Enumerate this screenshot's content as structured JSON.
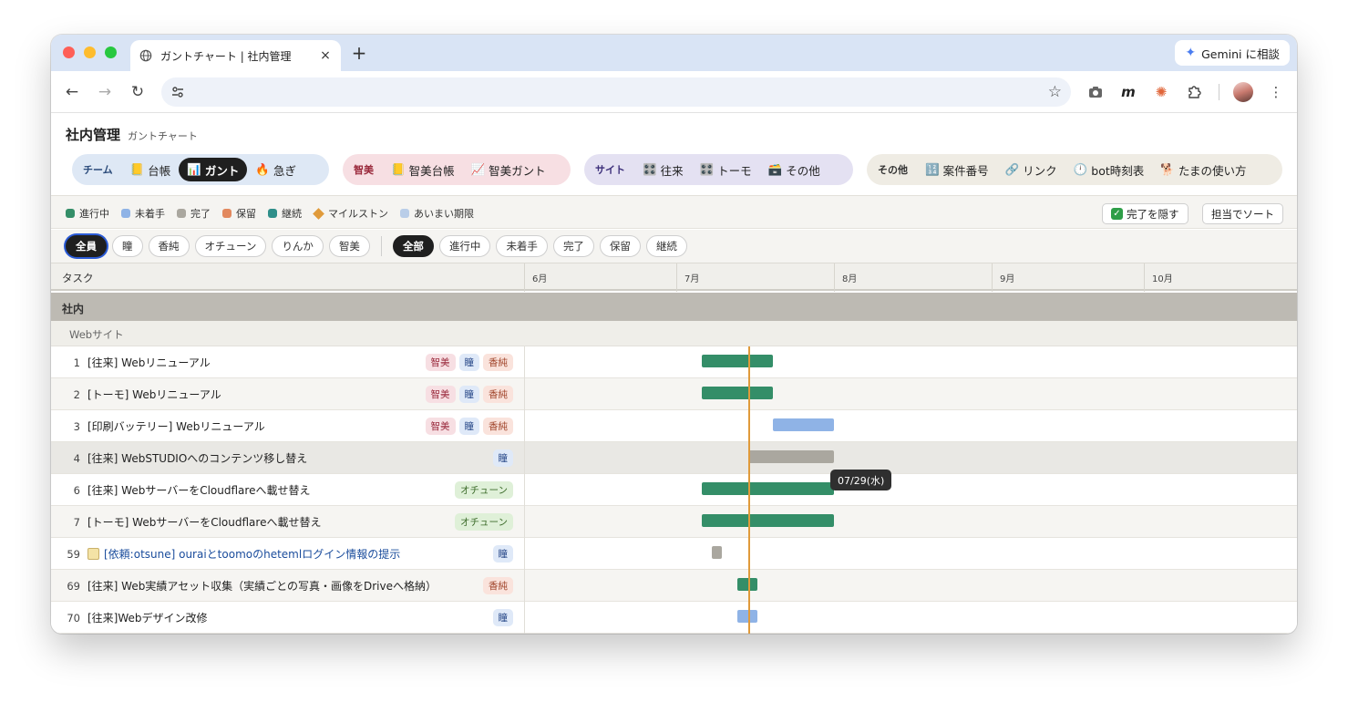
{
  "browser": {
    "tab_title": "ガントチャート | 社内管理",
    "new_tab": "+",
    "close": "×",
    "gemini_label": "Gemini に相談"
  },
  "app": {
    "title": "社内管理",
    "subtitle": "ガントチャート"
  },
  "nav_groups": [
    {
      "label": "チーム",
      "items": [
        {
          "icon": "ledger-icon",
          "glyph": "📒",
          "label": "台帳"
        },
        {
          "icon": "chart-icon",
          "glyph": "📊",
          "label": "ガント",
          "active": true
        },
        {
          "icon": "fire-icon",
          "glyph": "🔥",
          "label": "急ぎ"
        }
      ]
    },
    {
      "label": "智美",
      "items": [
        {
          "icon": "ledger-icon",
          "glyph": "📒",
          "label": "智美台帳"
        },
        {
          "icon": "chart-up-icon",
          "glyph": "📈",
          "label": "智美ガント"
        }
      ]
    },
    {
      "label": "サイト",
      "items": [
        {
          "icon": "grid-icon",
          "glyph": "🎛️",
          "label": "往来"
        },
        {
          "icon": "grid-icon",
          "glyph": "🎛️",
          "label": "トーモ"
        },
        {
          "icon": "box-icon",
          "glyph": "🗃️",
          "label": "その他"
        }
      ]
    },
    {
      "label": "その他",
      "items": [
        {
          "icon": "numbers-icon",
          "glyph": "🔢",
          "label": "案件番号"
        },
        {
          "icon": "link-icon",
          "glyph": "🔗",
          "label": "リンク"
        },
        {
          "icon": "clock-icon",
          "glyph": "🕛",
          "label": "bot時刻表"
        },
        {
          "icon": "dog-icon",
          "glyph": "🐕",
          "label": "たまの使い方"
        }
      ]
    }
  ],
  "legend": [
    {
      "label": "進行中",
      "color": "#348e68",
      "shape": "square"
    },
    {
      "label": "未着手",
      "color": "#8fb3e6",
      "shape": "square"
    },
    {
      "label": "完了",
      "color": "#aaa79f",
      "shape": "square"
    },
    {
      "label": "保留",
      "color": "#e2895f",
      "shape": "square"
    },
    {
      "label": "継続",
      "color": "#2f8f8a",
      "shape": "square"
    },
    {
      "label": "マイルストン",
      "color": "#e09a3a",
      "shape": "diamond"
    },
    {
      "label": "あいまい期限",
      "color": "#b9cde8",
      "shape": "square"
    }
  ],
  "actions": {
    "hide_done": "完了を隠す",
    "sort_by_owner": "担当でソート"
  },
  "member_filters": [
    {
      "label": "全員",
      "selected": true
    },
    {
      "label": "瞳"
    },
    {
      "label": "香純"
    },
    {
      "label": "オチューン"
    },
    {
      "label": "りんか"
    },
    {
      "label": "智美"
    }
  ],
  "status_filters": [
    {
      "label": "全部",
      "selected": true
    },
    {
      "label": "進行中"
    },
    {
      "label": "未着手"
    },
    {
      "label": "完了"
    },
    {
      "label": "保留"
    },
    {
      "label": "継続"
    }
  ],
  "gantt": {
    "task_header": "タスク",
    "months": [
      "6月",
      "7月",
      "8月",
      "9月",
      "10月"
    ],
    "section": "社内",
    "subsection": "Webサイト",
    "tooltip": "07/29(水)",
    "rows": [
      {
        "num": "1",
        "name": "[往来] Webリニューアル",
        "tags": [
          {
            "t": "智美",
            "c": "pink"
          },
          {
            "t": "瞳",
            "c": "blue"
          },
          {
            "t": "香純",
            "c": "salmon"
          }
        ],
        "status": "prog"
      },
      {
        "num": "2",
        "name": "[トーモ] Webリニューアル",
        "tags": [
          {
            "t": "智美",
            "c": "pink"
          },
          {
            "t": "瞳",
            "c": "blue"
          },
          {
            "t": "香純",
            "c": "salmon"
          }
        ],
        "status": "prog"
      },
      {
        "num": "3",
        "name": "[印刷バッテリー] Webリニューアル",
        "tags": [
          {
            "t": "智美",
            "c": "pink"
          },
          {
            "t": "瞳",
            "c": "blue"
          },
          {
            "t": "香純",
            "c": "salmon"
          }
        ],
        "status": "todo"
      },
      {
        "num": "4",
        "name": "[往来] WebSTUDIOへのコンテンツ移し替え",
        "tags": [
          {
            "t": "瞳",
            "c": "blue"
          }
        ],
        "status": "done"
      },
      {
        "num": "6",
        "name": "[往来] WebサーバーをCloudflareへ載せ替え",
        "tags": [
          {
            "t": "オチューン",
            "c": "green"
          }
        ],
        "status": "prog"
      },
      {
        "num": "7",
        "name": "[トーモ] WebサーバーをCloudflareへ載せ替え",
        "tags": [
          {
            "t": "オチューン",
            "c": "green"
          }
        ],
        "status": "prog"
      },
      {
        "num": "59",
        "name": "[依頼:otsune] ouraiとtoomoのhetemlログイン情報の提示",
        "tags": [
          {
            "t": "瞳",
            "c": "blue"
          }
        ],
        "status": "done",
        "link": true,
        "memo": true
      },
      {
        "num": "69",
        "name": "[往来] Web実績アセット収集（実績ごとの写真・画像をDriveへ格納）",
        "tags": [
          {
            "t": "香純",
            "c": "salmon"
          }
        ],
        "status": "prog"
      },
      {
        "num": "70",
        "name": "[往来]Webデザイン改修",
        "tags": [
          {
            "t": "瞳",
            "c": "blue"
          }
        ],
        "status": "todo"
      }
    ]
  }
}
